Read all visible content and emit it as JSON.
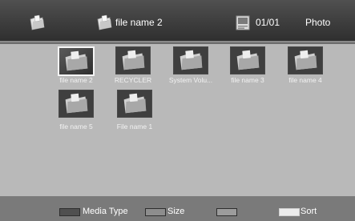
{
  "header": {
    "root_icon": "folder-icon",
    "file_icon": "folder-icon",
    "title": "file name 2",
    "page_icon": "page-icon",
    "page_count": "01/01",
    "mode": "Photo"
  },
  "items": [
    {
      "label": "file name 2",
      "icon": "folder-thumbnail-icon",
      "selected": true
    },
    {
      "label": "RECYCLER",
      "icon": "folder-thumbnail-icon",
      "selected": false
    },
    {
      "label": "System Volu...",
      "icon": "folder-thumbnail-icon",
      "selected": false
    },
    {
      "label": "file name 3",
      "icon": "folder-thumbnail-icon",
      "selected": false
    },
    {
      "label": "file name 4",
      "icon": "folder-thumbnail-icon",
      "selected": false
    },
    {
      "label": "file name 5",
      "icon": "folder-thumbnail-icon",
      "selected": false
    },
    {
      "label": "File name 1",
      "icon": "folder-thumbnail-icon",
      "selected": false
    }
  ],
  "footer": {
    "keys": [
      {
        "label": "Media Type",
        "color": "#505050"
      },
      {
        "label": "Size",
        "color": "#8d8d8d"
      },
      {
        "label": "",
        "color": "#9c9c9c"
      },
      {
        "label": "Sort",
        "color": "#ececec"
      }
    ]
  },
  "colors": {
    "header_bg": "#3c3c3c",
    "content_bg": "#b9b9b9",
    "footer_bg": "#7a7a7a",
    "selection_border": "#f4f4f4"
  }
}
